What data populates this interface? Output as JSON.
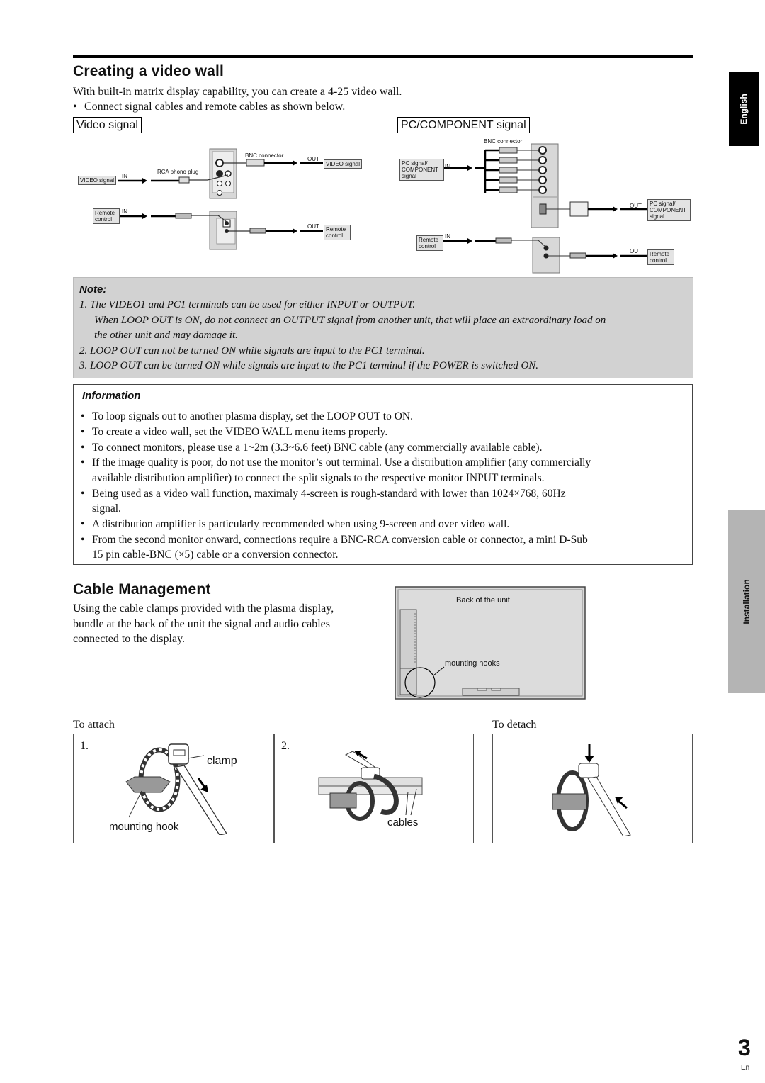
{
  "side_tabs": {
    "language": "English",
    "section": "Installation"
  },
  "video_wall": {
    "title": "Creating a video wall",
    "intro": "With built-in matrix display capability, you can create a 4-25 video wall.",
    "bullet": "Connect signal cables and remote cables as shown below.",
    "video_diagram": {
      "heading": "Video signal",
      "in_source": "VIDEO signal",
      "in_label": "IN",
      "rca_label": "RCA phono plug",
      "bnc_label": "BNC connector",
      "out_label": "OUT",
      "out_target": "VIDEO signal",
      "remote_in_source": "Remote control",
      "remote_in_label": "IN",
      "remote_out_label": "OUT",
      "remote_out_target": "Remote control"
    },
    "pc_diagram": {
      "heading": "PC/COMPONENT signal",
      "bnc_label": "BNC connector",
      "in_source": "PC signal/ COMPONENT signal",
      "in_label": "IN",
      "out_label": "OUT",
      "out_target": "PC signal/ COMPONENT signal",
      "remote_in_source": "Remote control",
      "remote_in_label": "IN",
      "remote_out_label": "OUT",
      "remote_out_target": "Remote control"
    }
  },
  "note": {
    "title": "Note:",
    "items": [
      "1.  The VIDEO1 and PC1 terminals can be used for either INPUT or OUTPUT.",
      "When LOOP OUT is ON, do not connect an OUTPUT signal from another unit, that will place an extraordinary load on",
      "the other unit and may damage it.",
      "2.  LOOP OUT can not be turned ON while signals are input to the PC1 terminal.",
      "3.  LOOP OUT can be turned ON while signals are input to the PC1 terminal if the POWER is switched ON."
    ]
  },
  "information": {
    "title": "Information",
    "items": [
      "To loop signals out to another plasma display, set the LOOP OUT to ON.",
      "To create a video wall, set the VIDEO WALL menu items properly.",
      "To connect monitors, please use a 1~2m (3.3~6.6 feet) BNC cable (any commercially available cable).",
      "If the image quality is poor, do not use the monitor’s out terminal. Use a distribution amplifier (any commercially",
      "available distribution amplifier) to connect the split signals to the respective monitor INPUT terminals.",
      "Being used as a video wall function, maximaly 4-screen is rough-standard with lower than 1024×768, 60Hz",
      "signal.",
      "A distribution amplifier is particularly recommended when using 9-screen and over video wall.",
      "From the second monitor onward, connections require a BNC-RCA conversion cable or connector, a mini D-Sub",
      "15 pin cable-BNC (×5) cable or a conversion connector."
    ]
  },
  "cable_management": {
    "title": "Cable Management",
    "lines": [
      "Using the cable clamps provided with the plasma display,",
      "bundle at the back of the unit the signal and audio cables",
      "connected to the display."
    ],
    "back_label": "Back of the unit",
    "hooks_label": "mounting hooks",
    "attach_label": "To attach",
    "detach_label": "To detach",
    "step1_num": "1.",
    "step2_num": "2.",
    "clamp_label": "clamp",
    "hook_label": "mounting hook",
    "cables_label": "cables"
  },
  "footer": {
    "page_number": "3",
    "lang_code": "En"
  }
}
